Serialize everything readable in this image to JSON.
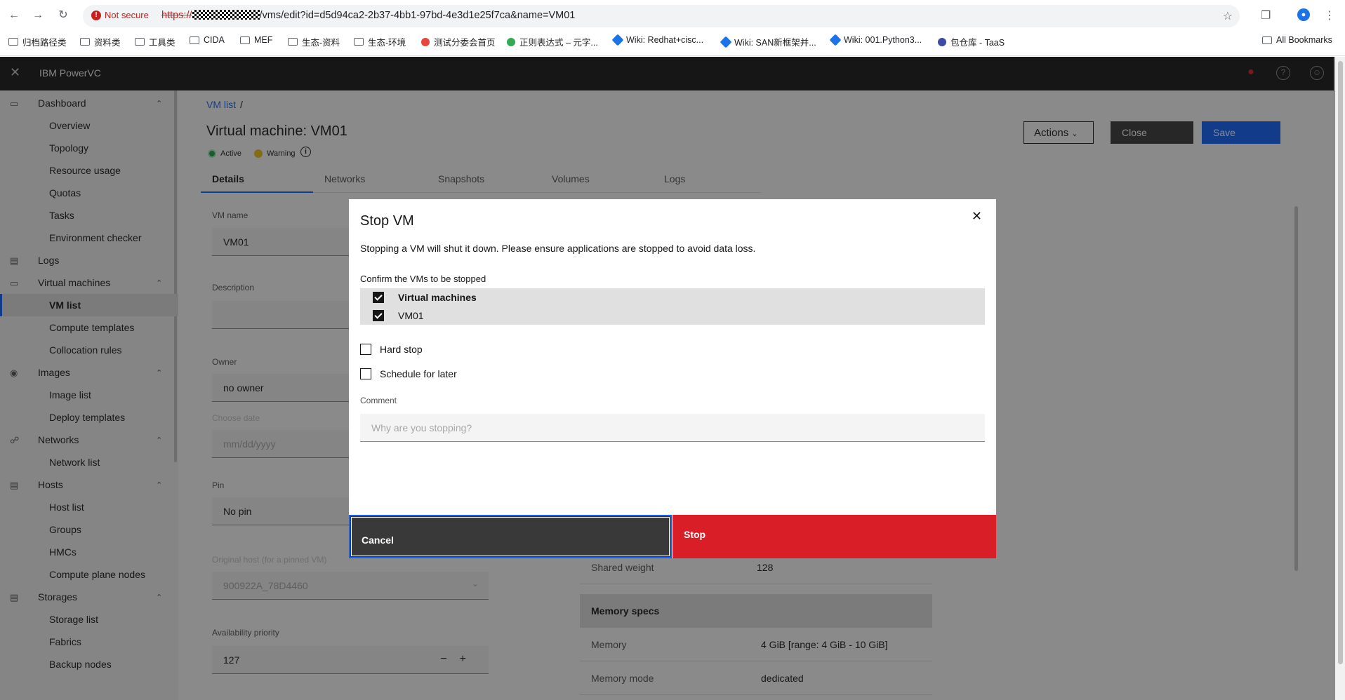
{
  "browser": {
    "not_secure": "Not secure",
    "url_proto": "https://",
    "url_path": "/vms/edit?id=d5d94ca2-2b37-4bb1-97bd-4e3d1e25f7ca&name=VM01",
    "bookmarks": [
      "归档路径类",
      "资料类",
      "工具类",
      "CIDA",
      "MEF",
      "生态-资料",
      "生态-环境",
      "测试分委会首页",
      "正则表达式 – 元字...",
      "Wiki: Redhat+cisc...",
      "Wiki: SAN新框架并...",
      "Wiki: 001.Python3...",
      "包仓库 - TaaS"
    ],
    "all_bookmarks": "All Bookmarks"
  },
  "app": {
    "title": "IBM PowerVC"
  },
  "sidebar": {
    "sections": [
      {
        "label": "Dashboard",
        "items": [
          "Overview",
          "Topology",
          "Resource usage",
          "Quotas",
          "Tasks",
          "Environment checker"
        ]
      },
      {
        "label": "Logs",
        "items": []
      },
      {
        "label": "Virtual machines",
        "items": [
          "VM list",
          "Compute templates",
          "Collocation rules"
        ]
      },
      {
        "label": "Images",
        "items": [
          "Image list",
          "Deploy templates"
        ]
      },
      {
        "label": "Networks",
        "items": [
          "Network list"
        ]
      },
      {
        "label": "Hosts",
        "items": [
          "Host list",
          "Groups",
          "HMCs",
          "Compute plane nodes"
        ]
      },
      {
        "label": "Storages",
        "items": [
          "Storage list",
          "Fabrics",
          "Backup nodes"
        ]
      }
    ]
  },
  "page": {
    "breadcrumb": "VM list",
    "breadcrumb_sep": "/",
    "title": "Virtual machine: VM01",
    "status_active": "Active",
    "status_warning": "Warning",
    "actions_label": "Actions",
    "close_label": "Close",
    "save_label": "Save",
    "tabs": [
      "Details",
      "Networks",
      "Snapshots",
      "Volumes",
      "Logs"
    ],
    "fields": {
      "vm_name_label": "VM name",
      "vm_name_value": "VM01",
      "description_label": "Description",
      "owner_label": "Owner",
      "owner_value": "no owner",
      "choose_date_label": "Choose date",
      "choose_date_placeholder": "mm/dd/yyyy",
      "pin_label": "Pin",
      "pin_value": "No pin",
      "original_host_label": "Original host (for a pinned VM)",
      "original_host_value": "900922A_78D4460",
      "availability_label": "Availability priority",
      "availability_value": "127"
    },
    "specs": {
      "shared_weight_label": "Shared weight",
      "shared_weight_value": "128",
      "memory_specs_header": "Memory specs",
      "memory_label": "Memory",
      "memory_value": "4 GiB [range: 4 GiB - 10 GiB]",
      "memory_mode_label": "Memory mode",
      "memory_mode_value": "dedicated"
    }
  },
  "modal": {
    "title": "Stop VM",
    "description": "Stopping a VM will shut it down. Please ensure applications are stopped to avoid data loss.",
    "confirm_label": "Confirm the VMs to be stopped",
    "header_row": "Virtual machines",
    "vm_row": "VM01",
    "hard_stop": "Hard stop",
    "schedule": "Schedule for later",
    "comment_label": "Comment",
    "comment_placeholder": "Why are you stopping?",
    "cancel_label": "Cancel",
    "stop_label": "Stop"
  },
  "colors": {
    "primary": "#0f62fe",
    "danger": "#da1e28",
    "active": "#24a148",
    "warning": "#f1c21b"
  }
}
